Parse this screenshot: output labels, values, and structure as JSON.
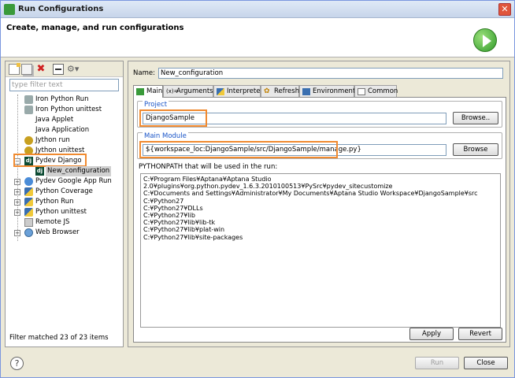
{
  "window": {
    "title": "Run Configurations"
  },
  "header": {
    "title": "Create, manage, and run configurations"
  },
  "left": {
    "filter_placeholder": "type filter text",
    "filter_status": "Filter matched 23 of 23 items",
    "tree": [
      {
        "label": "Iron Python Run",
        "icon": "iron-python-icon"
      },
      {
        "label": "Iron Python unittest",
        "icon": "iron-python-icon"
      },
      {
        "label": "Java Applet",
        "icon": "java-icon"
      },
      {
        "label": "Java Application",
        "icon": "java-icon"
      },
      {
        "label": "Jython run",
        "icon": "jython-icon"
      },
      {
        "label": "Jython unittest",
        "icon": "jython-icon"
      },
      {
        "label": "Pydev Django",
        "icon": "django-icon"
      },
      {
        "label": "New_configuration",
        "icon": "django-icon"
      },
      {
        "label": "Pydev Google App Run",
        "icon": "google-app-icon"
      },
      {
        "label": "Python Coverage",
        "icon": "python-icon"
      },
      {
        "label": "Python Run",
        "icon": "python-icon"
      },
      {
        "label": "Python unittest",
        "icon": "python-icon"
      },
      {
        "label": "Remote JS",
        "icon": "remote-js-icon"
      },
      {
        "label": "Web Browser",
        "icon": "web-browser-icon"
      }
    ]
  },
  "right": {
    "name_label": "Name:",
    "name_value": "New_configuration",
    "tabs": [
      {
        "label": "Main"
      },
      {
        "label": "Arguments"
      },
      {
        "label": "Interpreter"
      },
      {
        "label": "Refresh"
      },
      {
        "label": "Environment"
      },
      {
        "label": "Common"
      }
    ],
    "project": {
      "title": "Project",
      "value": "DjangoSample",
      "button": "Browse.."
    },
    "main_module": {
      "title": "Main Module",
      "value": "${workspace_loc:DjangoSample/src/DjangoSample/manage.py}",
      "button": "Browse"
    },
    "pythonpath_label": "PYTHONPATH that will be used in the run:",
    "pythonpath": [
      "C:¥Program Files¥Aptana¥Aptana Studio 2.0¥plugins¥org.python.pydev_1.6.3.2010100513¥PySrc¥pydev_sitecustomize",
      "C:¥Documents and Settings¥Administrator¥My Documents¥Aptana Studio Workspace¥DjangoSample¥src",
      "C:¥Python27",
      "C:¥Python27¥DLLs",
      "C:¥Python27¥lib",
      "C:¥Python27¥lib¥lib-tk",
      "C:¥Python27¥lib¥plat-win",
      "C:¥Python27¥lib¥site-packages"
    ],
    "apply_button": "Apply",
    "revert_button": "Revert"
  },
  "footer": {
    "help": "?",
    "run_button": "Run",
    "close_button": "Close"
  },
  "colors": {
    "highlight": "#f08a30",
    "group_title": "#1a55c8",
    "run_green": "#2f9a2a"
  }
}
